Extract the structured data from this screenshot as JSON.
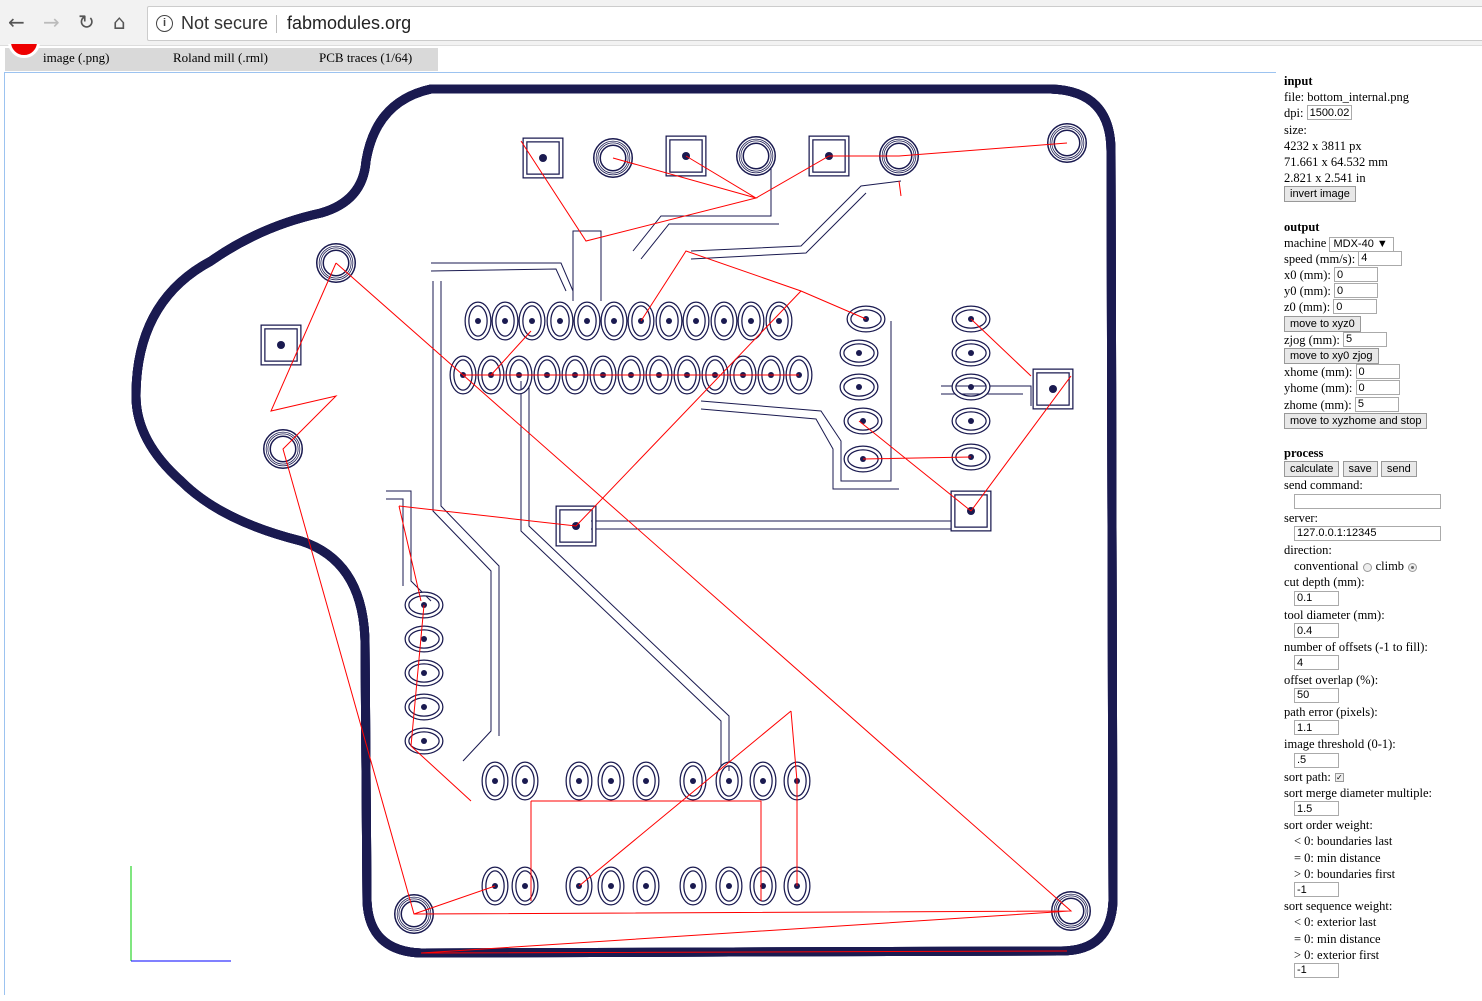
{
  "browser": {
    "security": "Not secure",
    "url": "fabmodules.org"
  },
  "tabs": [
    "image (.png)",
    "Roland mill (.rml)",
    "PCB traces (1/64)"
  ],
  "input": {
    "heading": "input",
    "file": "file: bottom_internal.png",
    "dpi_label": "dpi:",
    "dpi": "1500.02:",
    "size_label": "size:",
    "px": "4232 x 3811 px",
    "mm": "71.661 x 64.532 mm",
    "in": "2.821 x 2.541 in",
    "invert": "invert image"
  },
  "output": {
    "heading": "output",
    "machine_label": "machine",
    "machine": "MDX-40 ▼",
    "speed_label": "speed (mm/s):",
    "speed": "4",
    "x0_label": "x0 (mm):",
    "x0": "0",
    "y0_label": "y0 (mm):",
    "y0": "0",
    "z0_label": "z0 (mm):",
    "z0": "0",
    "move_xyz0": "move to xyz0",
    "zjog_label": "zjog (mm):",
    "zjog": "5",
    "move_zjog": "move to xy0 zjog",
    "xhome_label": "xhome (mm):",
    "xhome": "0",
    "yhome_label": "yhome (mm):",
    "yhome": "0",
    "zhome_label": "zhome (mm):",
    "zhome": "5",
    "move_home": "move to xyzhome and stop"
  },
  "process": {
    "heading": "process",
    "calculate": "calculate",
    "save": "save",
    "send": "send",
    "send_command_label": "send command:",
    "send_command": "",
    "server_label": "server:",
    "server": "127.0.0.1:12345",
    "direction_label": "direction:",
    "conventional": "conventional",
    "climb": "climb",
    "direction": "climb",
    "cut_depth_label": "cut depth (mm):",
    "cut_depth": "0.1",
    "tool_diameter_label": "tool diameter (mm):",
    "tool_diameter": "0.4",
    "offsets_label": "number of offsets (-1 to fill):",
    "offsets": "4",
    "overlap_label": "offset overlap (%):",
    "overlap": "50",
    "path_error_label": "path error (pixels):",
    "path_error": "1.1",
    "threshold_label": "image threshold (0-1):",
    "threshold": ".5",
    "sort_path_label": "sort path:",
    "sort_path": true,
    "merge_label": "sort merge diameter multiple:",
    "merge": "1.5",
    "order_label": "sort order weight:",
    "order_opts": [
      "< 0: boundaries last",
      "= 0: min distance",
      "> 0: boundaries first"
    ],
    "order": "-1",
    "sequence_label": "sort sequence weight:",
    "sequence_opts": [
      "< 0: exterior last",
      "= 0: min distance",
      "> 0: exterior first"
    ],
    "sequence": "-1"
  },
  "colors": {
    "toolpath": "#1a1a50",
    "jog": "#ff0000",
    "x_axis": "#0000ff",
    "y_axis": "#00cc00"
  }
}
